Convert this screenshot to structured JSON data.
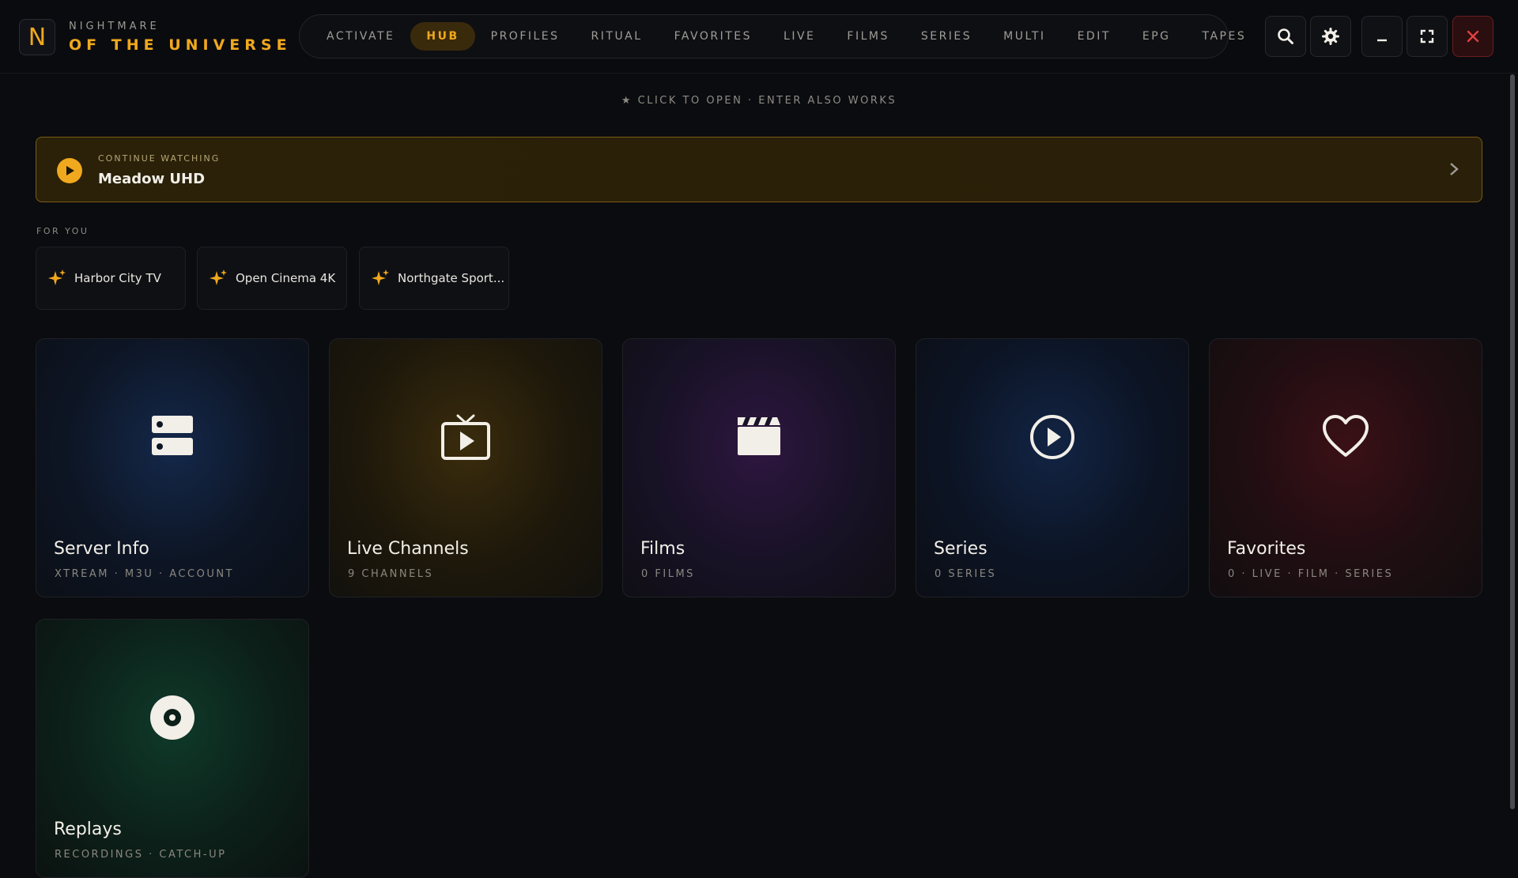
{
  "brand": {
    "line1": "NIGHTMARE",
    "line2": "OF THE UNIVERSE",
    "logo_letter": "N"
  },
  "nav": {
    "tabs": [
      {
        "label": "ACTIVATE"
      },
      {
        "label": "HUB"
      },
      {
        "label": "PROFILES"
      },
      {
        "label": "RITUAL"
      },
      {
        "label": "FAVORITES"
      },
      {
        "label": "LIVE"
      },
      {
        "label": "FILMS"
      },
      {
        "label": "SERIES"
      },
      {
        "label": "MULTI"
      },
      {
        "label": "EDIT"
      },
      {
        "label": "EPG"
      },
      {
        "label": "TAPES"
      }
    ],
    "active": "HUB"
  },
  "window_controls": [
    "search-icon",
    "gear-icon",
    "minimize-icon",
    "fullscreen-icon",
    "close-icon"
  ],
  "hint": "★  CLICK TO OPEN  ·  ENTER ALSO WORKS",
  "continue_watching": {
    "label": "CONTINUE WATCHING",
    "title": "Meadow UHD"
  },
  "for_you": {
    "label": "FOR YOU",
    "items": [
      {
        "label": "Harbor City TV"
      },
      {
        "label": "Open Cinema 4K"
      },
      {
        "label": "Northgate Sport..."
      }
    ]
  },
  "cards": [
    {
      "title": "Server Info",
      "sub": "XTREAM · M3U · ACCOUNT",
      "icon": "server-icon"
    },
    {
      "title": "Live Channels",
      "sub": "9 CHANNELS",
      "icon": "tv-play-icon"
    },
    {
      "title": "Films",
      "sub": "0 FILMS",
      "icon": "clapperboard-icon"
    },
    {
      "title": "Series",
      "sub": "0 SERIES",
      "icon": "play-circle-icon"
    },
    {
      "title": "Favorites",
      "sub": "0 · LIVE · FILM · SERIES",
      "icon": "heart-icon"
    },
    {
      "title": "Replays",
      "sub": "RECORDINGS · CATCH-UP",
      "icon": "disc-icon"
    }
  ],
  "colors": {
    "accent": "#f0a81e",
    "background": "#0b0c0f",
    "close": "#e0403f"
  }
}
